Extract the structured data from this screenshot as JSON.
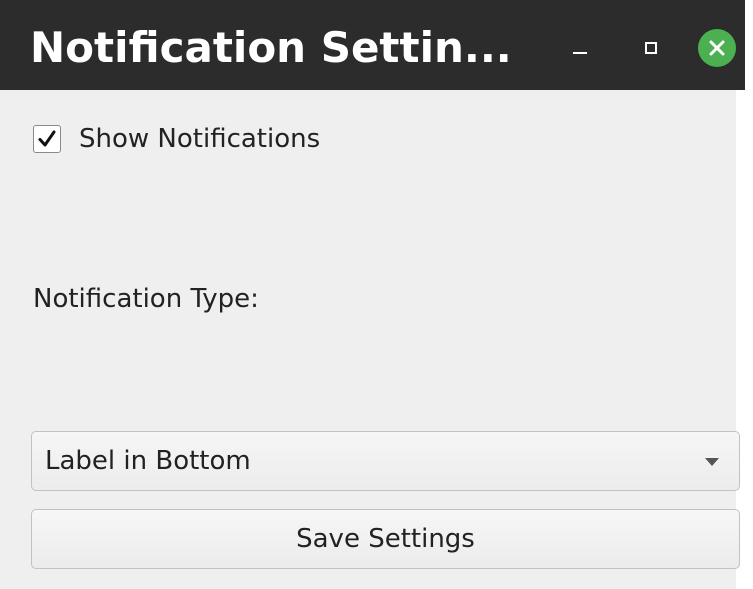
{
  "window": {
    "title": "Notification Settin...",
    "controls": {
      "minimize": "minimize-icon",
      "maximize": "maximize-icon",
      "close": "close-icon"
    },
    "close_color": "#4caf50"
  },
  "settings": {
    "show_notifications_label": "Show Notifications",
    "show_notifications_checked": true,
    "notification_type_label": "Notification Type:",
    "notification_type_selected": "Label in Bottom",
    "save_button_label": "Save Settings"
  }
}
